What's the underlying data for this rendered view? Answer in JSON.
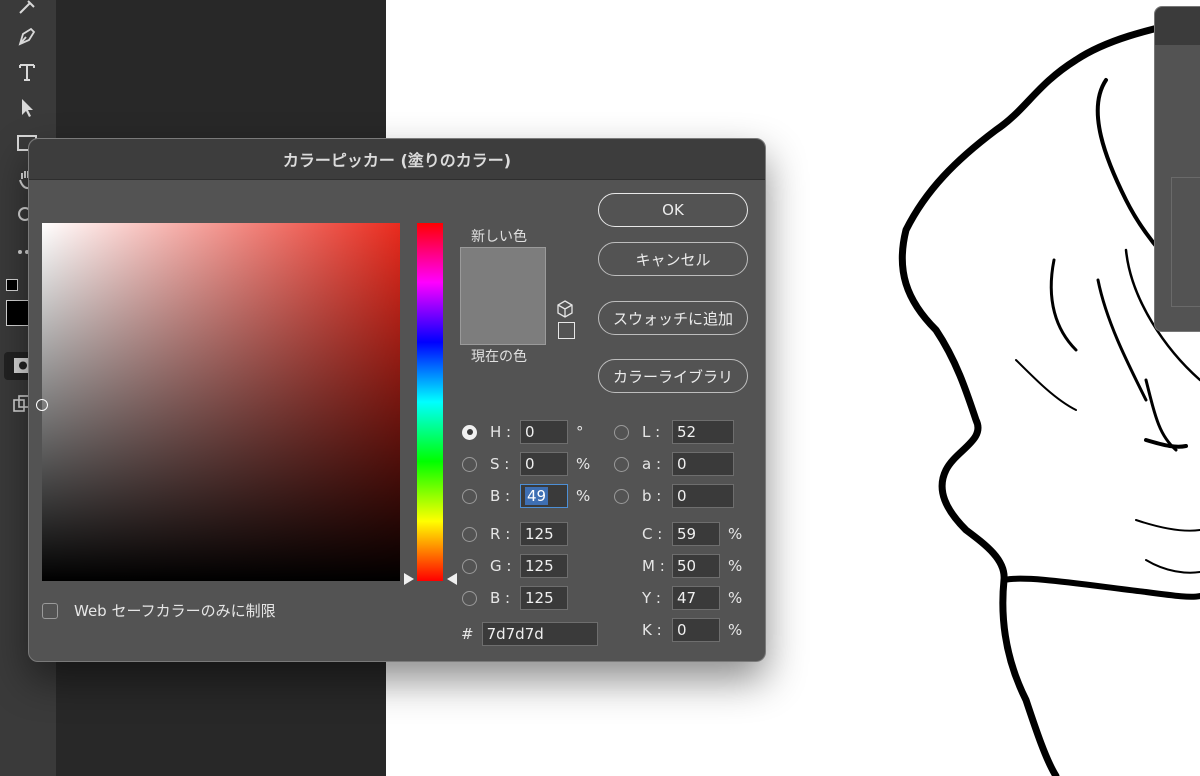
{
  "dialog": {
    "title": "カラーピッカー (塗りのカラー)",
    "new_color_label": "新しい色",
    "current_color_label": "現在の色",
    "new_color": "#7d7d7d",
    "current_color": "#7d7d7d",
    "buttons": {
      "ok": "OK",
      "cancel": "キャンセル",
      "add_to_swatches": "スウォッチに追加",
      "color_libraries": "カラーライブラリ"
    },
    "websafe_only_label": "Web セーフカラーのみに制限",
    "websafe_only_checked": false,
    "selected_mode": "H",
    "hsb": [
      {
        "label": "H :",
        "value": "0",
        "unit": "°"
      },
      {
        "label": "S :",
        "value": "0",
        "unit": "%"
      },
      {
        "label": "B :",
        "value": "49",
        "unit": "%"
      }
    ],
    "rgb": [
      {
        "label": "R :",
        "value": "125"
      },
      {
        "label": "G :",
        "value": "125"
      },
      {
        "label": "B :",
        "value": "125"
      }
    ],
    "lab": [
      {
        "label": "L :",
        "value": "52"
      },
      {
        "label": "a :",
        "value": "0"
      },
      {
        "label": "b :",
        "value": "0"
      }
    ],
    "cmyk": [
      {
        "label": "C :",
        "value": "59",
        "unit": "%"
      },
      {
        "label": "M :",
        "value": "50",
        "unit": "%"
      },
      {
        "label": "Y :",
        "value": "47",
        "unit": "%"
      },
      {
        "label": "K :",
        "value": "0",
        "unit": "%"
      }
    ],
    "hex_label": "#",
    "hex_value": "7d7d7d"
  },
  "colors": {
    "field_hue": "#ea2b1e",
    "dialog_bg": "#535353",
    "focus_accent": "#4d8fd6"
  },
  "toolbar": {
    "tools": [
      "pen-tool-icon",
      "type-tool-icon",
      "path-selection-tool-icon",
      "rectangle-tool-icon",
      "hand-tool-icon",
      "zoom-tool-icon",
      "more-tools-icon"
    ],
    "foreground_color": "#000000"
  }
}
